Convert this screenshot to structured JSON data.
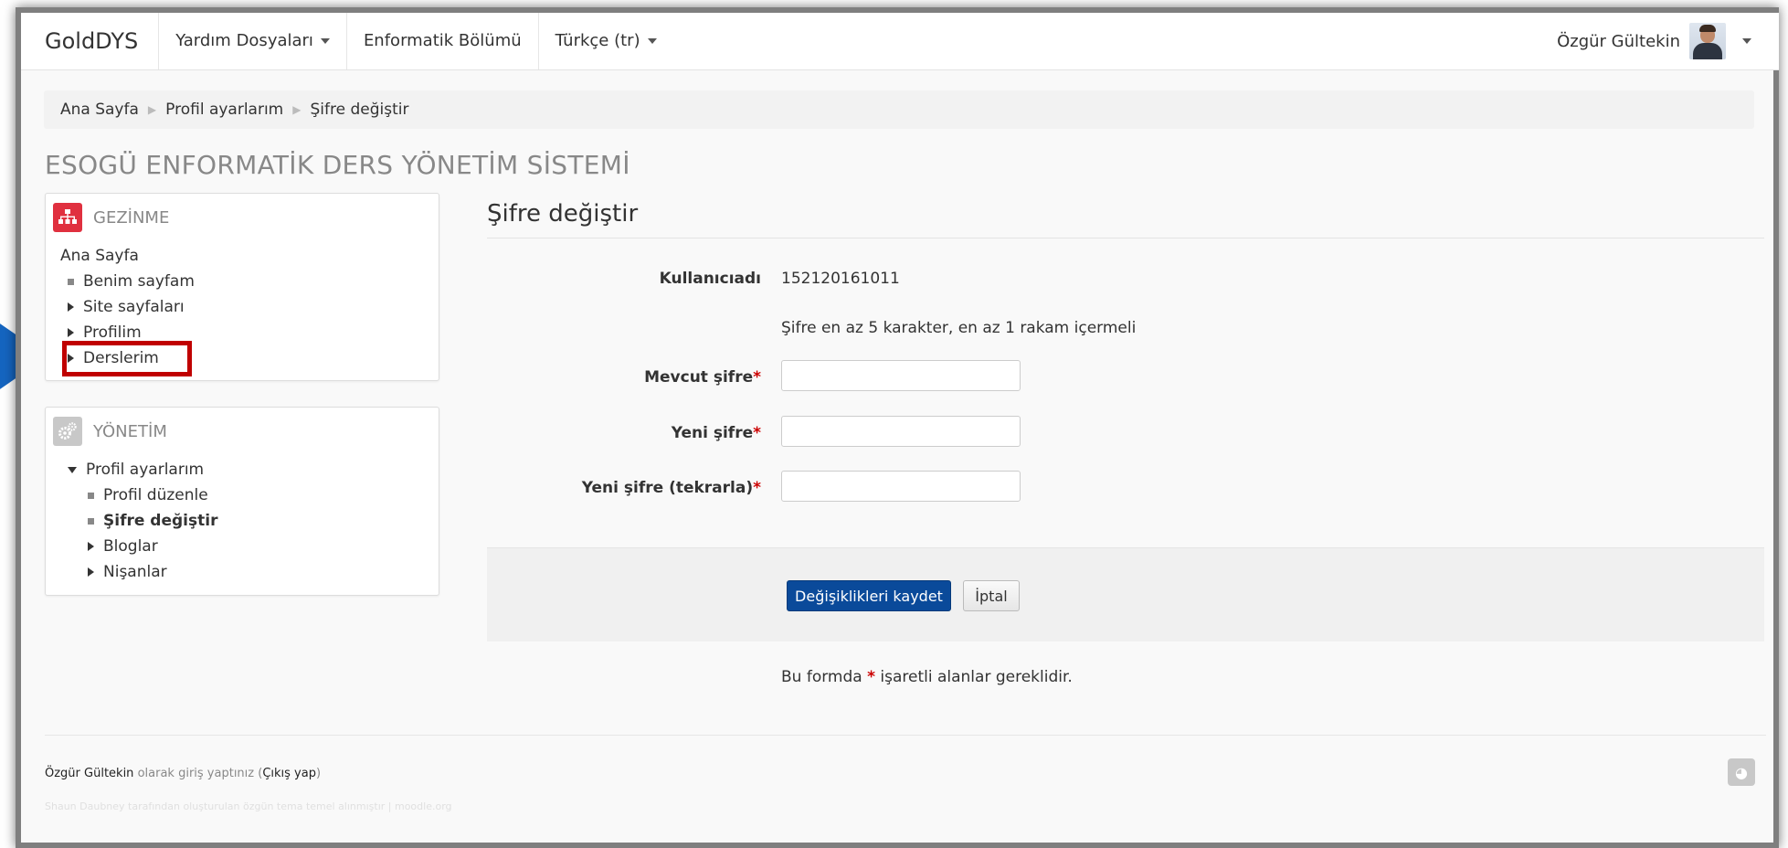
{
  "navbar": {
    "brand": "GoldDYS",
    "menu": [
      "Yardım Dosyaları",
      "Enformatik Bölümü",
      "Türkçe (tr)"
    ],
    "user_name": "Özgür Gültekin"
  },
  "breadcrumb": [
    "Ana Sayfa",
    "Profil ayarlarım",
    "Şifre değiştir"
  ],
  "page_header": "ESOGÜ ENFORMATİK DERS YÖNETİM SİSTEMİ",
  "gezinme": {
    "title": "GEZİNME",
    "root": "Ana Sayfa",
    "items": [
      "Benim sayfam",
      "Site sayfaları",
      "Profilim",
      "Derslerim"
    ]
  },
  "yonetim": {
    "title": "YÖNETİM",
    "root": "Profil ayarlarım",
    "items": [
      "Profil düzenle",
      "Şifre değiştir",
      "Bloglar",
      "Nişanlar"
    ]
  },
  "form": {
    "title": "Şifre değiştir",
    "username_label": "Kullanıcıadı",
    "username_value": "152120161011",
    "password_hint": "Şifre en az 5 karakter, en az 1 rakam içermeli",
    "current_label": "Mevcut şifre",
    "new_label": "Yeni şifre",
    "repeat_label": "Yeni şifre (tekrarla)",
    "required_mark": "*",
    "save_button": "Değişiklikleri kaydet",
    "cancel_button": "İptal",
    "required_note_pre": "Bu formda",
    "required_note_post": "işaretli alanlar gereklidir."
  },
  "footer": {
    "user": "Özgür Gültekin",
    "logged_in_text": "olarak giriş yaptınız (",
    "logout": "Çıkış yap",
    "close_paren": ")",
    "credit": "Shaun Daubney tarafından oluşturulan özgün tema temel alınmıştır  |  moodle.org"
  },
  "colors": {
    "primary_button": "#0a4a9a",
    "highlight_box": "#c00000",
    "arrow": "#1565c0",
    "gezinme_icon": "#e04040"
  }
}
